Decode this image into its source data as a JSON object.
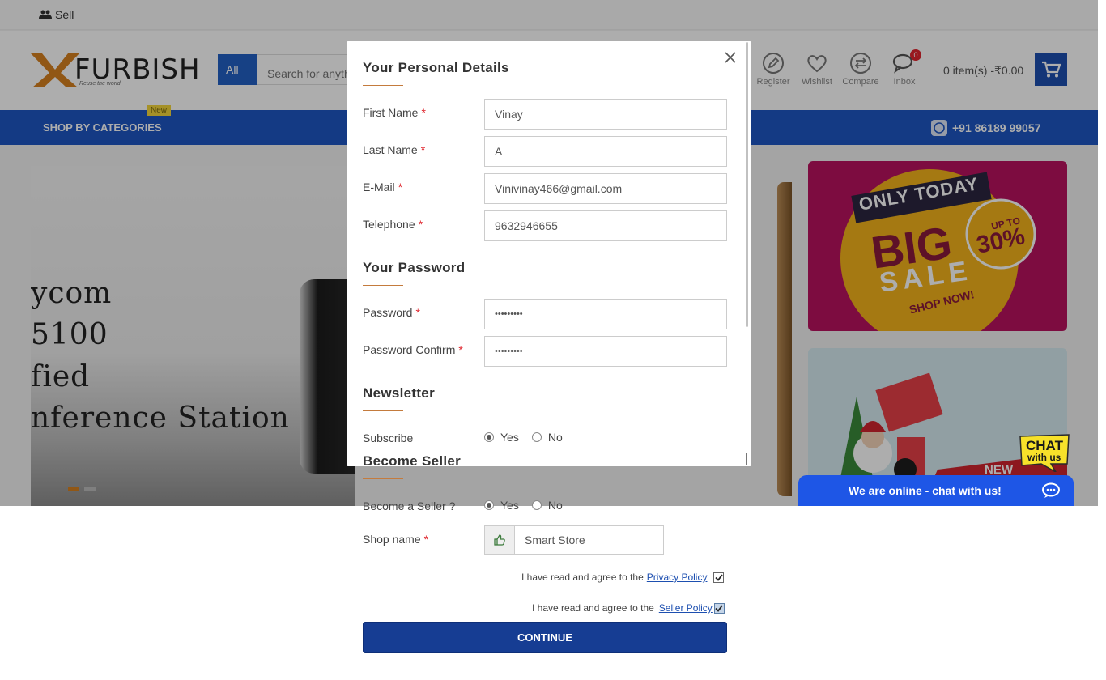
{
  "topbar": {
    "sell_label": "Sell"
  },
  "header": {
    "logo_text": "FURBISH",
    "logo_tagline": "Reuse the world",
    "search_category": "All",
    "search_placeholder": "Search for anyth",
    "icons": [
      {
        "label": "Register",
        "icon": "pencil-circle-icon"
      },
      {
        "label": "Wishlist",
        "icon": "heart-icon"
      },
      {
        "label": "Compare",
        "icon": "compare-arrows-icon"
      },
      {
        "label": "Inbox",
        "icon": "chat-icon",
        "badge": "0"
      }
    ],
    "cart_text": "0 item(s) -₹0.00"
  },
  "navbar": {
    "categories_label": "SHOP BY CATEGORIES",
    "new_tag": "New",
    "phone": "+91 86189 99057"
  },
  "hero": {
    "lines": [
      "ycom",
      "5100",
      "fied",
      "nference Station"
    ]
  },
  "promo": {
    "only_today": "ONLY TODAY",
    "big": "BIG",
    "sale": "SALE",
    "upto": "UP TO",
    "percent": "30%",
    "shop_now": "SHOP NOW!",
    "new_word": "NEW"
  },
  "chat": {
    "bubble_line1": "CHAT",
    "bubble_line2": "with us",
    "bar_text": "We are online - chat with us!"
  },
  "modal": {
    "personal": {
      "title": "Your Personal Details",
      "first_name_label": "First Name",
      "first_name_value": "Vinay",
      "last_name_label": "Last Name",
      "last_name_value": "A",
      "email_label": "E-Mail",
      "email_value": "Vinivinay466@gmail.com",
      "telephone_label": "Telephone",
      "telephone_value": "9632946655"
    },
    "password": {
      "title": "Your Password",
      "password_label": "Password",
      "password_value": "•••••••••",
      "confirm_label": "Password Confirm",
      "confirm_value": "•••••••••"
    },
    "newsletter": {
      "title": "Newsletter",
      "subscribe_label": "Subscribe",
      "yes": "Yes",
      "no": "No",
      "selected": "Yes"
    },
    "seller": {
      "title": "Become Seller",
      "become_label": "Become a Seller ?",
      "yes": "Yes",
      "no": "No",
      "selected": "Yes",
      "shop_label": "Shop name",
      "shop_value": "Smart Store"
    },
    "agreements": {
      "prefix": "I have read and agree to the",
      "privacy_link": "Privacy Policy",
      "seller_link": "Seller Policy",
      "privacy_checked": true,
      "seller_checked": true
    },
    "continue_label": "CONTINUE"
  },
  "colors": {
    "primary_blue": "#1e56c3",
    "button_blue": "#163d93",
    "accent_orange": "#c47b3d",
    "required_red": "#e0262e",
    "chat_blue": "#1e56e6"
  }
}
